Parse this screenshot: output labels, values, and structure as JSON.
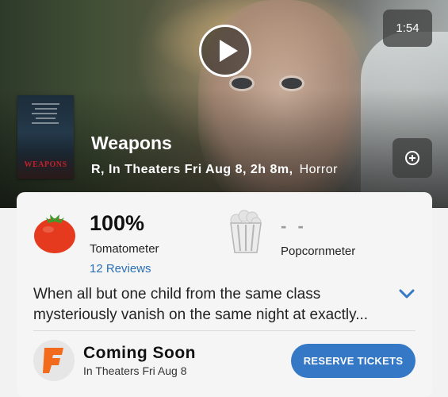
{
  "hero": {
    "duration": "1:54",
    "poster_title": "WEAPONS",
    "title": "Weapons",
    "meta": "R, In Theaters Fri Aug 8, 2h 8m,",
    "genre": "Horror",
    "icons": {
      "play": "play-icon",
      "add": "add-circle-icon"
    }
  },
  "scores": {
    "tomatometer_value": "100%",
    "tomatometer_label": "Tomatometer",
    "reviews_link": "12 Reviews",
    "popcornmeter_value": "- -",
    "popcornmeter_label": "Popcornmeter",
    "icons": {
      "tomato": "tomato-icon",
      "popcorn": "popcorn-bucket-icon"
    }
  },
  "synopsis": {
    "text": "When all but one child from the same class mysteriously vanish on the same night at exactly...",
    "expand_icon": "chevron-down-icon"
  },
  "tickets": {
    "status": "Coming Soon",
    "date": "In Theaters Fri Aug 8",
    "button_label": "RESERVE TICKETS",
    "logo_icon": "fandango-icon"
  },
  "colors": {
    "accent": "#3578c5",
    "link": "#2a6fb5",
    "tomato": "#e53a1e"
  }
}
